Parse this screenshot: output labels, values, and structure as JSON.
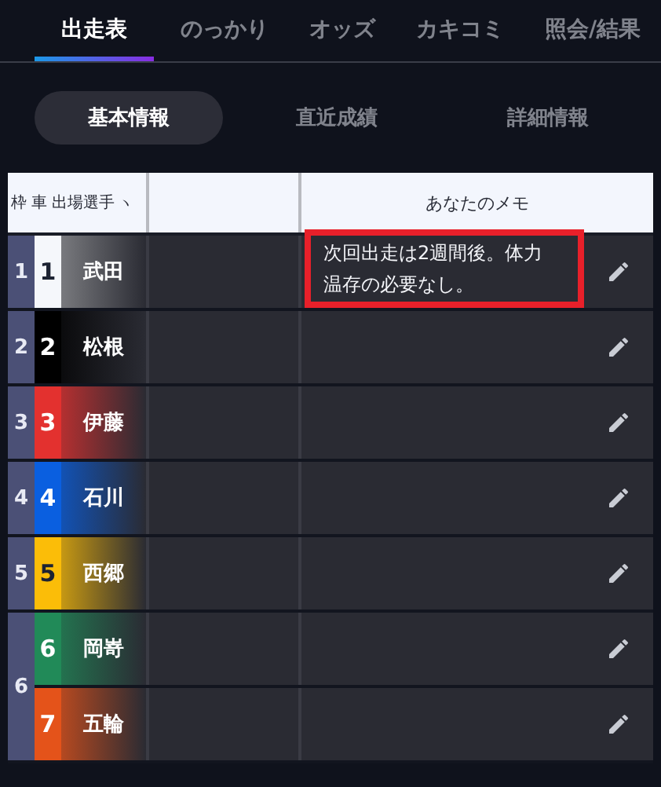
{
  "tabs": [
    {
      "label": "出走表",
      "selected": true
    },
    {
      "label": "のっかり",
      "selected": false
    },
    {
      "label": "オッズ",
      "selected": false
    },
    {
      "label": "カキコミ",
      "selected": false
    },
    {
      "label": "照会/結果",
      "selected": false
    }
  ],
  "segments": [
    {
      "label": "基本情報",
      "selected": true
    },
    {
      "label": "直近成績",
      "selected": false
    },
    {
      "label": "詳細情報",
      "selected": false
    }
  ],
  "table": {
    "columns": {
      "frame": "枠",
      "car": "車",
      "player": "出場選手",
      "sort_mark": "ヽ",
      "memo": "あなたのメモ"
    },
    "frames": [
      {
        "number": "1",
        "entries": [
          {
            "car": "1",
            "name": "武田",
            "color": "#f5f7fb",
            "memo": "次回出走は2週間後。体力温存の必要なし。",
            "highlighted": true
          }
        ]
      },
      {
        "number": "2",
        "entries": [
          {
            "car": "2",
            "name": "松根",
            "color": "#000000",
            "highlighted": false
          }
        ]
      },
      {
        "number": "3",
        "entries": [
          {
            "car": "3",
            "name": "伊藤",
            "color": "#e3312f",
            "highlighted": false
          }
        ]
      },
      {
        "number": "4",
        "entries": [
          {
            "car": "4",
            "name": "石川",
            "color": "#0a5fe0",
            "highlighted": false
          }
        ]
      },
      {
        "number": "5",
        "entries": [
          {
            "car": "5",
            "name": "西郷",
            "color": "#fbbd08",
            "highlighted": false
          }
        ]
      },
      {
        "number": "6",
        "entries": [
          {
            "car": "6",
            "name": "岡嵜",
            "color": "#218a58",
            "highlighted": false
          },
          {
            "car": "7",
            "name": "五輪",
            "color": "#e4531a",
            "highlighted": false
          }
        ]
      }
    ]
  }
}
